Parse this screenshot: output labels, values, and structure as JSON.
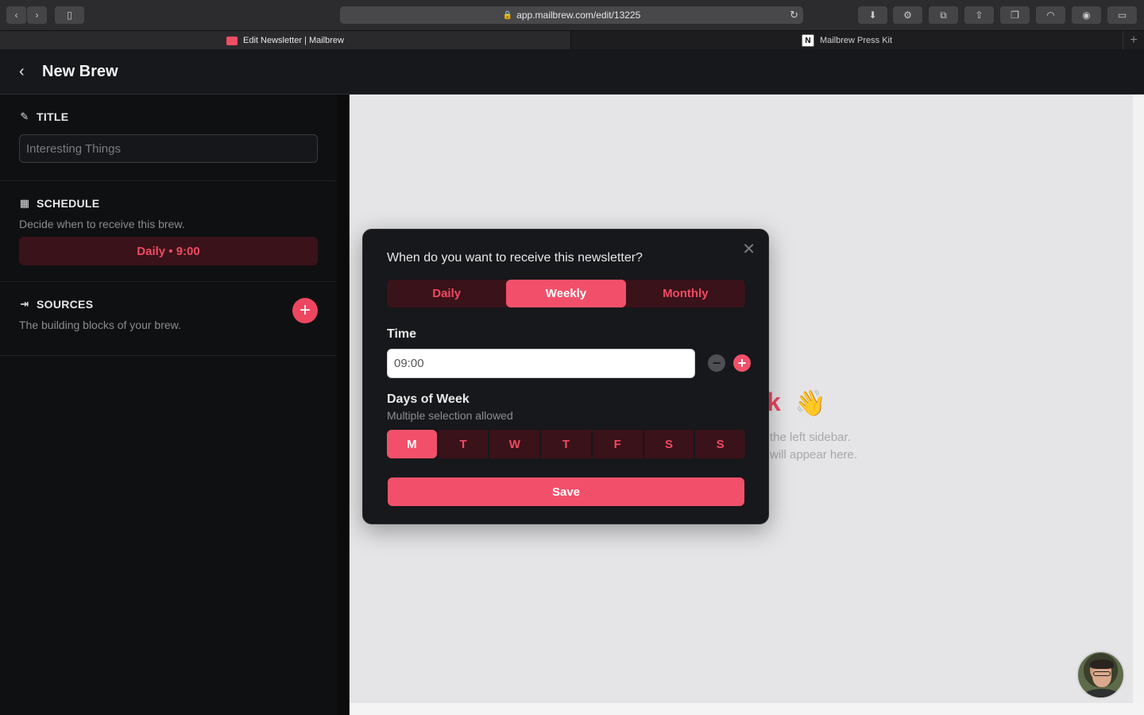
{
  "browser": {
    "url": "app.mailbrew.com/edit/13225",
    "tabs": [
      {
        "label": "Edit Newsletter | Mailbrew",
        "active": true
      },
      {
        "label": "Mailbrew Press Kit",
        "active": false
      }
    ],
    "new_tab": "+"
  },
  "header": {
    "title": "New Brew",
    "back_icon": "‹"
  },
  "sidebar": {
    "title_section": {
      "heading": "TITLE",
      "input_value": "Interesting Things"
    },
    "schedule_section": {
      "heading": "SCHEDULE",
      "subtitle": "Decide when to receive this brew.",
      "button_label": "Daily • 9:00"
    },
    "sources_section": {
      "heading": "SOURCES",
      "subtitle": "The building blocks of your brew.",
      "add_icon": "+"
    }
  },
  "preview": {
    "heading_fragment": "k",
    "emoji": "👋",
    "line1": "the left sidebar.",
    "line2": "will appear here."
  },
  "modal": {
    "question": "When do you want to receive this newsletter?",
    "frequency_options": [
      "Daily",
      "Weekly",
      "Monthly"
    ],
    "selected_frequency": "Weekly",
    "time_label": "Time",
    "time_value": "09:00",
    "days_label": "Days of Week",
    "days_sublabel": "Multiple selection allowed",
    "days": [
      "M",
      "T",
      "W",
      "T",
      "F",
      "S",
      "S"
    ],
    "selected_days": [
      "M"
    ],
    "save_label": "Save",
    "close_icon": "✕"
  },
  "colors": {
    "accent": "#f2506a",
    "accent_dark_bg": "#3a1219",
    "sidebar_bg": "#0f1012"
  }
}
